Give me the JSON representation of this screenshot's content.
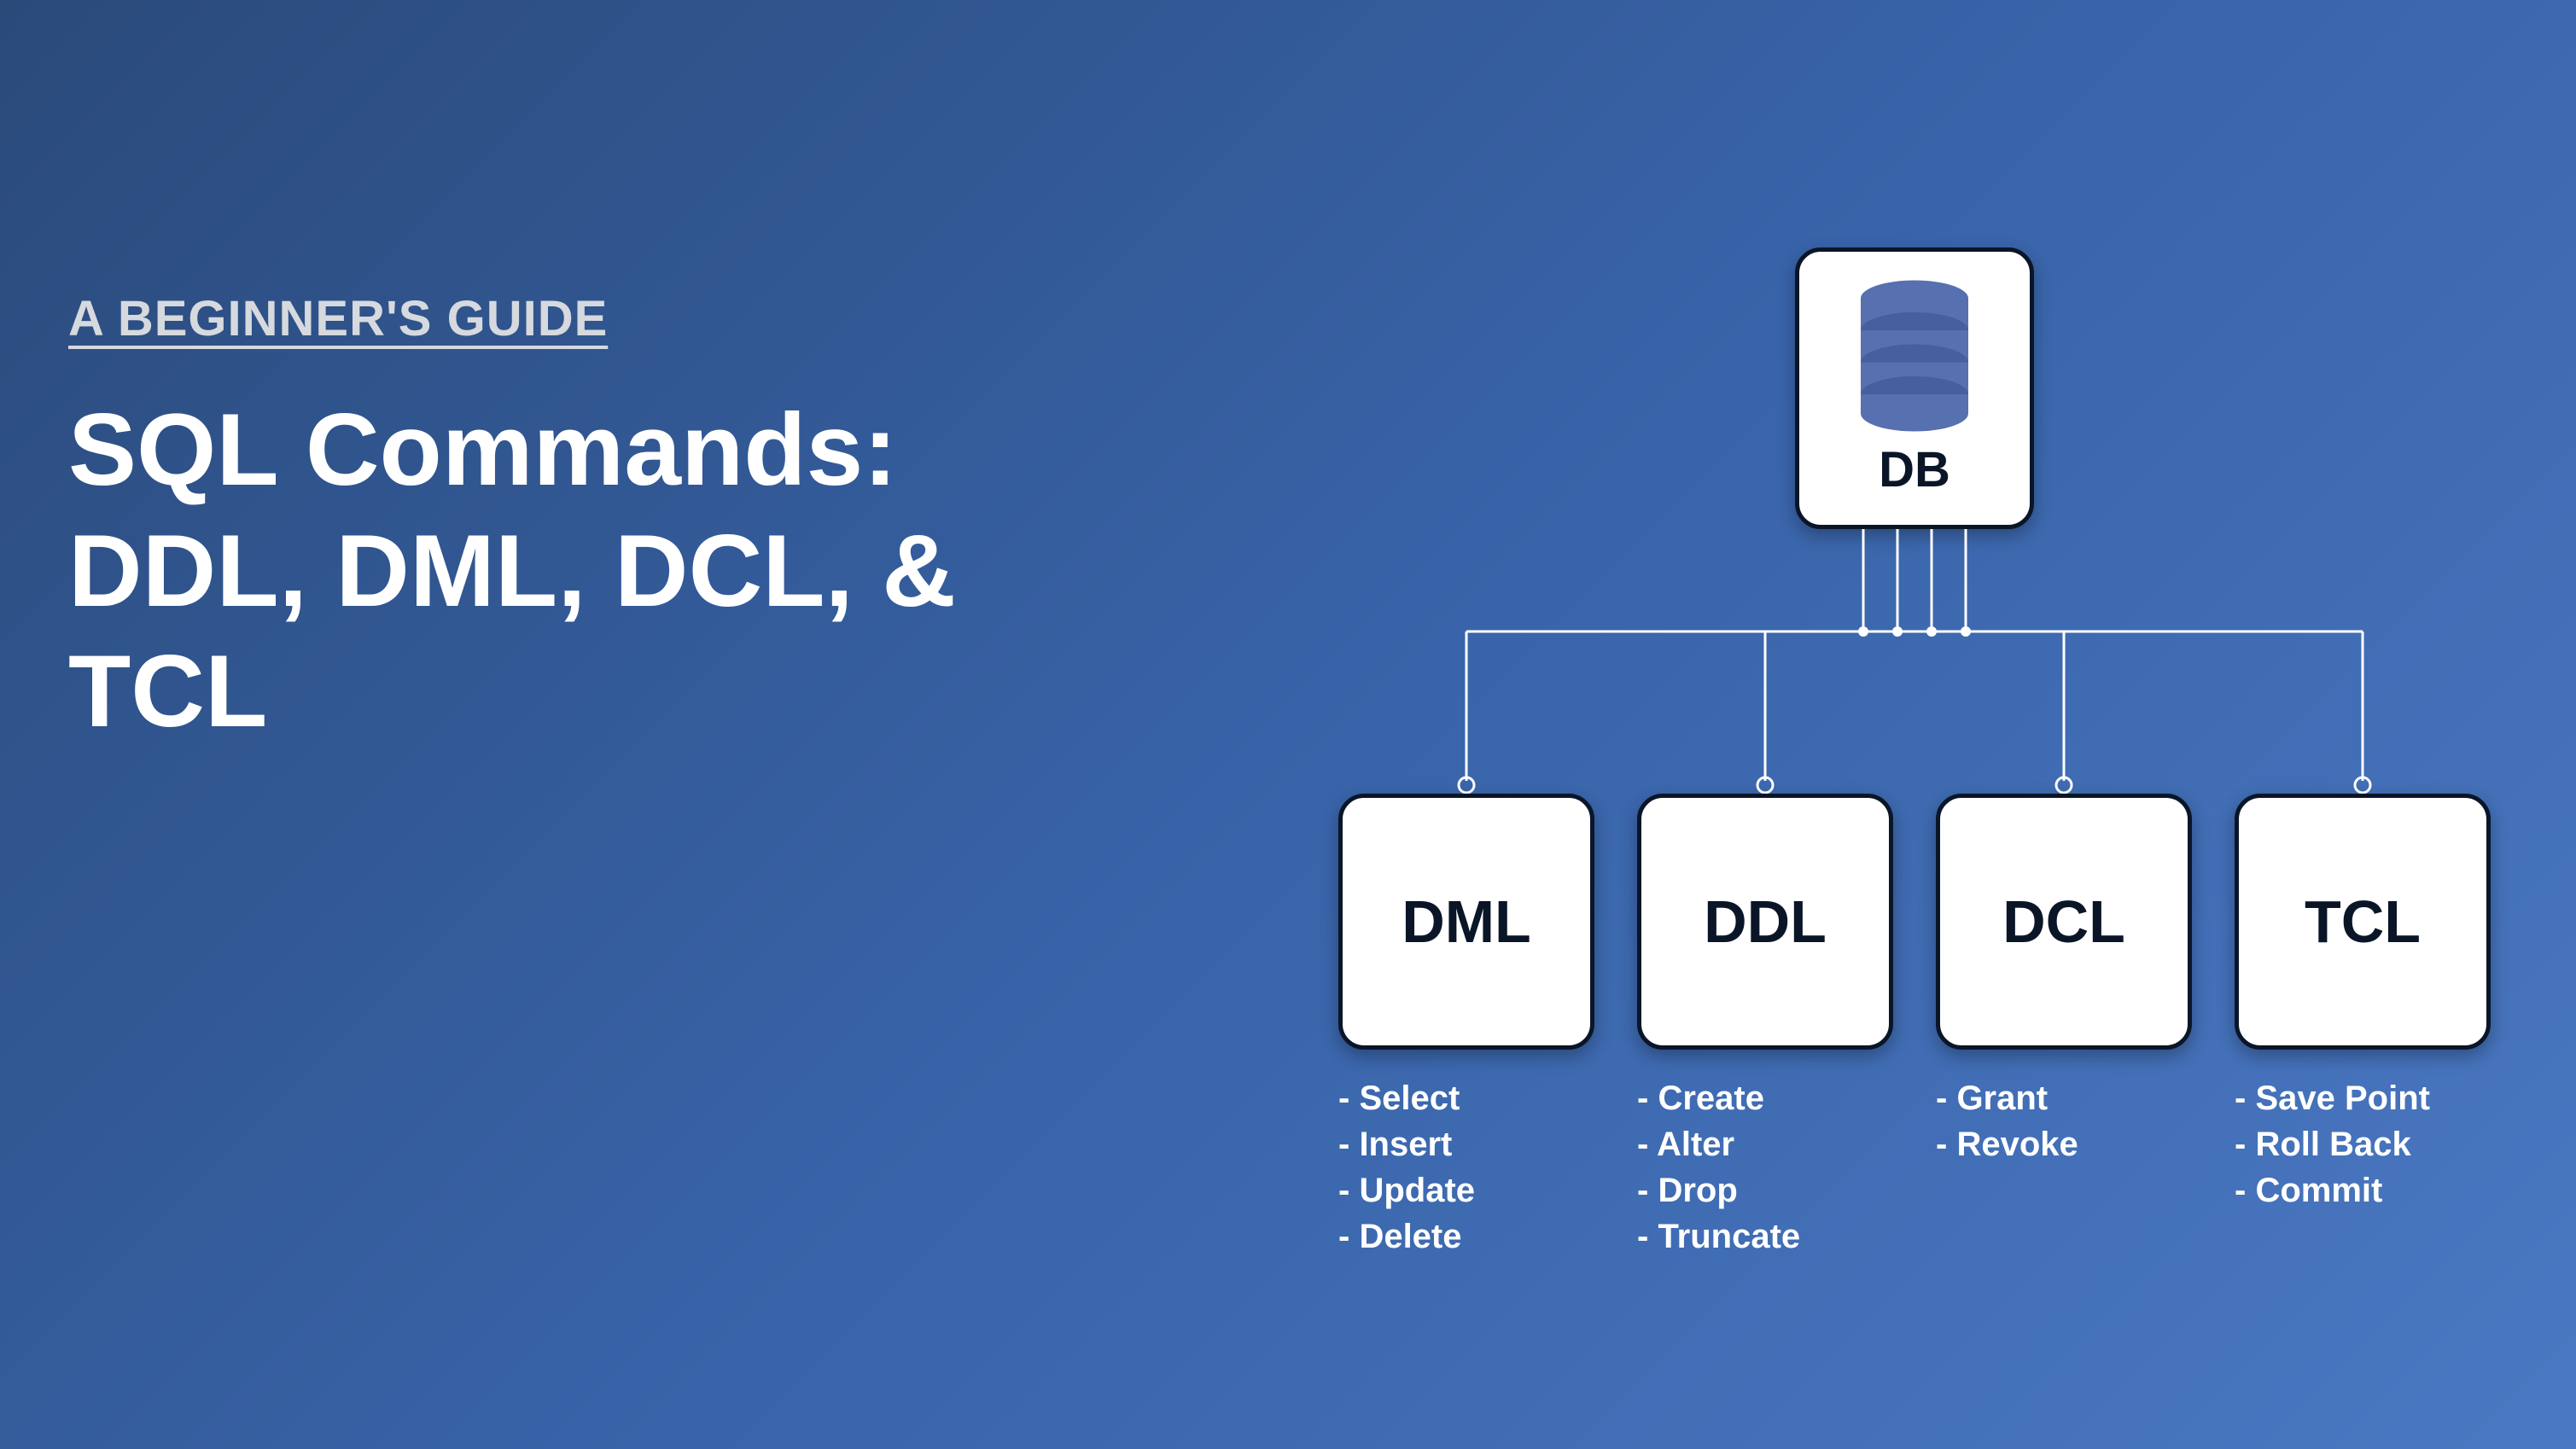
{
  "subtitle": "A BEGINNER'S GUIDE",
  "title_line1": "SQL Commands:",
  "title_line2": "DDL, DML, DCL, &",
  "title_line3": "TCL",
  "root": {
    "label": "DB"
  },
  "categories": [
    {
      "name": "DML",
      "commands": [
        "Select",
        "Insert",
        "Update",
        "Delete"
      ]
    },
    {
      "name": "DDL",
      "commands": [
        "Create",
        "Alter",
        "Drop",
        "Truncate"
      ]
    },
    {
      "name": "DCL",
      "commands": [
        "Grant",
        "Revoke"
      ]
    },
    {
      "name": "TCL",
      "commands": [
        "Save Point",
        "Roll Back",
        "Commit"
      ]
    }
  ],
  "colors": {
    "box_fill": "#ffffff",
    "box_border": "#0a1628",
    "db_cylinder": "#5670b0",
    "text_light": "#ffffff",
    "subtitle": "#d6d9de"
  }
}
